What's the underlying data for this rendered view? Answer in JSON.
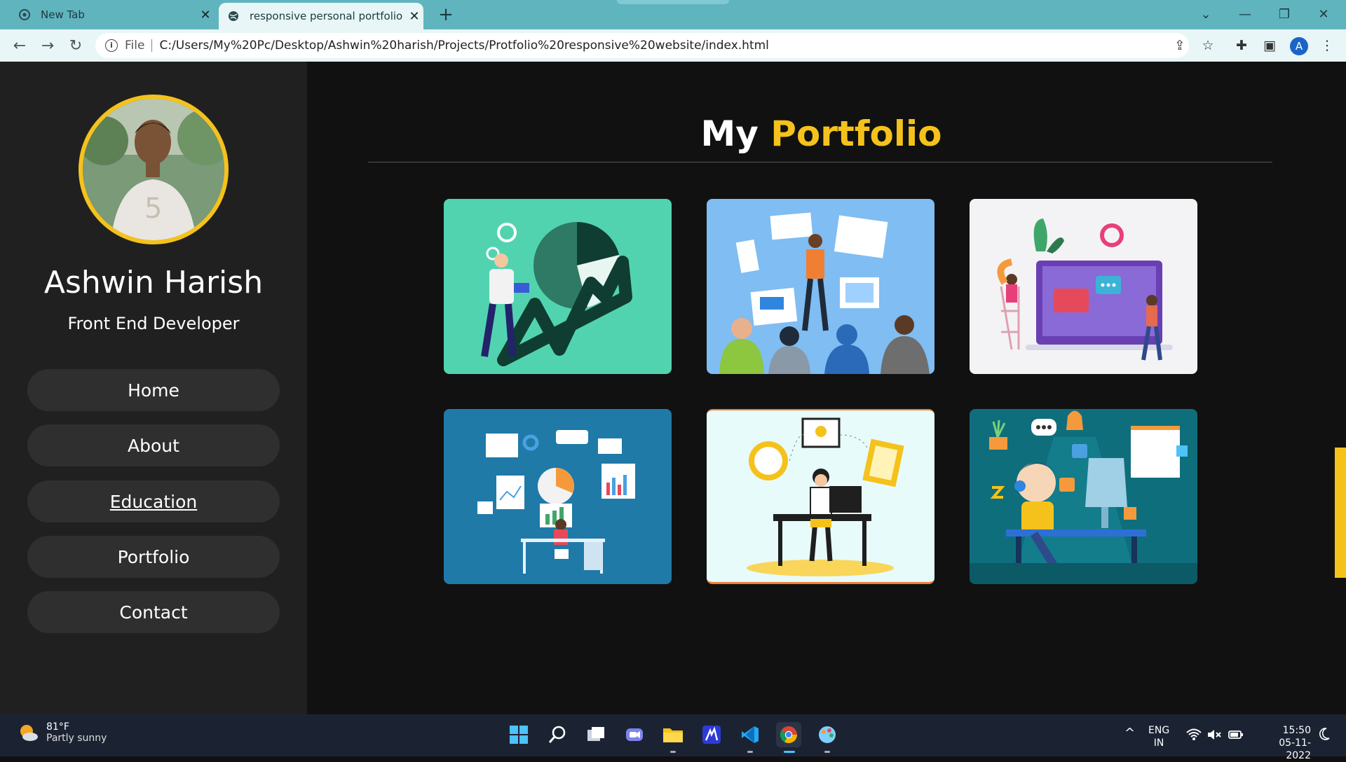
{
  "browser": {
    "tabs": [
      {
        "title": "New Tab"
      },
      {
        "title": "responsive personal portfolio website"
      }
    ],
    "address": {
      "scheme": "File",
      "url": "C:/Users/My%20Pc/Desktop/Ashwin%20harish/Projects/Protfolio%20responsive%20website/index.html"
    },
    "profile_initial": "A"
  },
  "sidebar": {
    "name": "Ashwin Harish",
    "role": "Front End Developer",
    "nav": [
      {
        "label": "Home"
      },
      {
        "label": "About"
      },
      {
        "label": "Education",
        "active": true
      },
      {
        "label": "Portfolio"
      },
      {
        "label": "Contact"
      }
    ]
  },
  "main": {
    "title_prefix": "My",
    "title_accent": "Portfolio",
    "cards": [
      {
        "bg": "#52d3b0",
        "icon": "growth-chart-illustration"
      },
      {
        "bg": "#7fbdf2",
        "icon": "team-presentation-illustration"
      },
      {
        "bg": "#f3f3f5",
        "icon": "laptop-chat-illustration"
      },
      {
        "bg": "#1f7aa8",
        "icon": "data-dashboard-illustration"
      },
      {
        "bg": "#e7fbfb",
        "icon": "designer-desk-illustration"
      },
      {
        "bg": "#0f6e7c",
        "icon": "developer-workspace-illustration"
      }
    ]
  },
  "taskbar": {
    "weather_temp": "81°F",
    "weather_cond": "Partly sunny",
    "lang_1": "ENG",
    "lang_2": "IN",
    "time": "15:50",
    "date": "05-11-2022"
  },
  "colors": {
    "accent": "#f5c21b",
    "sidebar_bg": "#202020",
    "page_bg": "#111111",
    "chrome": "#5fb4be"
  }
}
